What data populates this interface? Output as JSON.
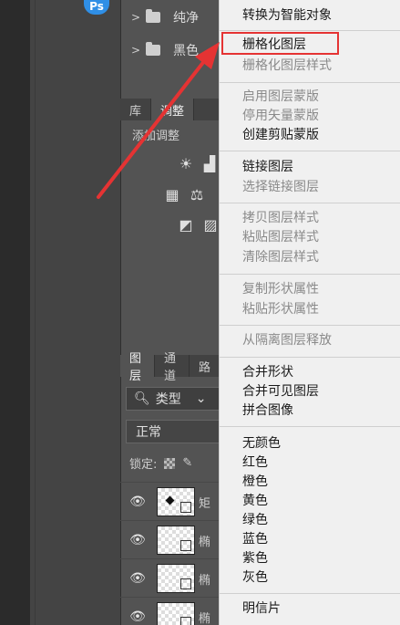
{
  "app": {
    "logo_text": "Ps"
  },
  "layer_groups": [
    {
      "name": "纯净"
    },
    {
      "name": "黑色"
    }
  ],
  "adjust_panel": {
    "tabs": [
      "库",
      "调整"
    ],
    "title": "添加调整"
  },
  "layers_panel": {
    "tabs": [
      "图层",
      "通道",
      "路"
    ],
    "filter_label": "类型",
    "blend_mode": "正常",
    "lock_label": "锁定:",
    "rows": [
      {
        "name": "矩"
      },
      {
        "name": "椭"
      },
      {
        "name": "椭"
      },
      {
        "name": "椭"
      }
    ]
  },
  "context_menu": {
    "items": [
      {
        "label": "转换为智能对象",
        "enabled": true
      },
      {
        "label": "栅格化图层",
        "enabled": true,
        "highlighted": true
      },
      {
        "label": "栅格化图层样式",
        "enabled": false
      },
      {
        "label": "启用图层蒙版",
        "enabled": false
      },
      {
        "label": "停用矢量蒙版",
        "enabled": false
      },
      {
        "label": "创建剪贴蒙版",
        "enabled": true
      },
      {
        "label": "链接图层",
        "enabled": true
      },
      {
        "label": "选择链接图层",
        "enabled": false
      },
      {
        "label": "拷贝图层样式",
        "enabled": false
      },
      {
        "label": "粘贴图层样式",
        "enabled": false
      },
      {
        "label": "清除图层样式",
        "enabled": false
      },
      {
        "label": "复制形状属性",
        "enabled": false
      },
      {
        "label": "粘贴形状属性",
        "enabled": false
      },
      {
        "label": "从隔离图层释放",
        "enabled": false
      },
      {
        "label": "合并形状",
        "enabled": true
      },
      {
        "label": "合并可见图层",
        "enabled": true
      },
      {
        "label": "拼合图像",
        "enabled": true
      },
      {
        "label": "无颜色",
        "enabled": true
      },
      {
        "label": "红色",
        "enabled": true
      },
      {
        "label": "橙色",
        "enabled": true
      },
      {
        "label": "黄色",
        "enabled": true
      },
      {
        "label": "绿色",
        "enabled": true
      },
      {
        "label": "蓝色",
        "enabled": true
      },
      {
        "label": "紫色",
        "enabled": true
      },
      {
        "label": "灰色",
        "enabled": true
      },
      {
        "label": "明信片",
        "enabled": true
      }
    ]
  },
  "colors": {
    "highlight_border": "#e53333",
    "arrow": "#e53333",
    "menu_bg": "#f0f0f0",
    "panel_bg": "#535353"
  }
}
